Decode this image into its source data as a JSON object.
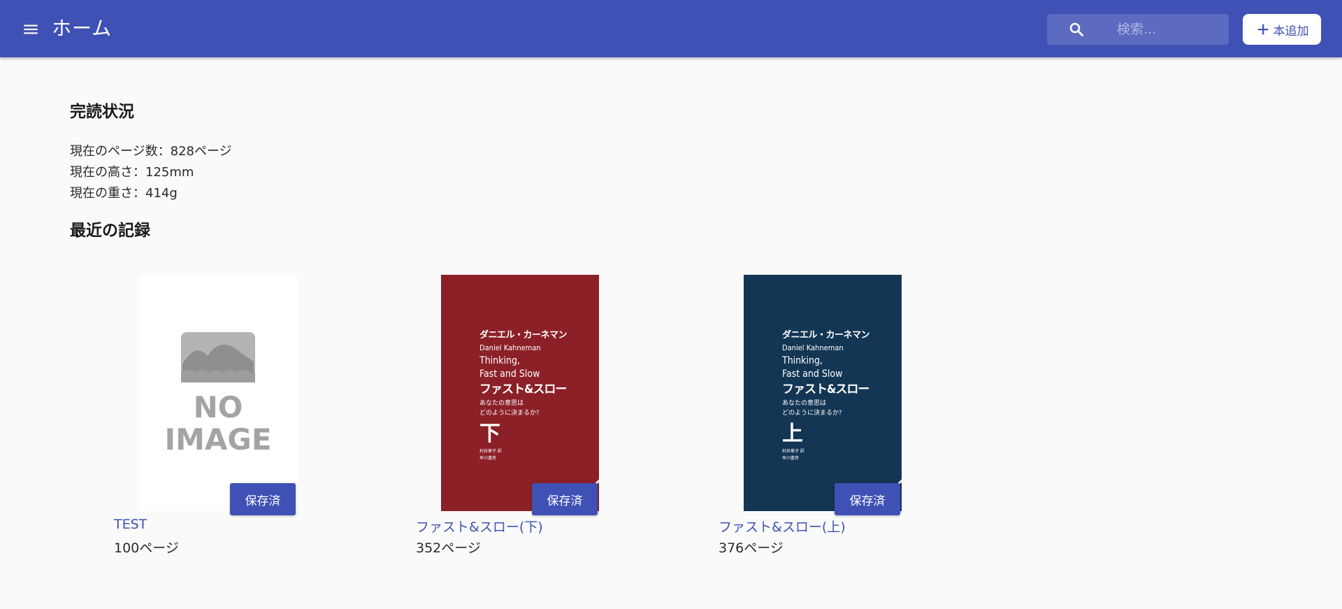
{
  "header": {
    "title": "ホーム",
    "search_placeholder": "検索...",
    "add_button_label": "本追加"
  },
  "status": {
    "heading": "完読状況",
    "pages_line": "現在のページ数：828ページ",
    "height_line": "現在の高さ：125mm",
    "weight_line": "現在の重さ：414g"
  },
  "recent": {
    "heading": "最近の記録",
    "books": [
      {
        "title": "TEST",
        "pages": "100ページ",
        "saved_label": "保存済",
        "cover_text": {
          "line1": "NO",
          "line2": "IMAGE"
        }
      },
      {
        "title": "ファスト&スロー(下)",
        "pages": "352ページ",
        "saved_label": "保存済",
        "cover_text": {
          "author_ja": "ダニエル・カーネマン",
          "author_en": "Daniel Kahneman",
          "title_en_1": "Thinking,",
          "title_en_2": "Fast and Slow",
          "title_ja": "ファスト&スロー",
          "subtitle_1": "あなたの意思は",
          "subtitle_2": "どのように決まるか?",
          "volume": "下",
          "translator": "村井章子 訳",
          "publisher": "早川書房"
        },
        "cover_color": "#8b2027"
      },
      {
        "title": "ファスト&スロー(上)",
        "pages": "376ページ",
        "saved_label": "保存済",
        "cover_text": {
          "author_ja": "ダニエル・カーネマン",
          "author_en": "Daniel Kahneman",
          "title_en_1": "Thinking,",
          "title_en_2": "Fast and Slow",
          "title_ja": "ファスト&スロー",
          "subtitle_1": "あなたの意思は",
          "subtitle_2": "どのように決まるか?",
          "volume": "上",
          "translator": "村井章子 訳",
          "publisher": "早川書房"
        },
        "cover_color": "#143655"
      }
    ]
  },
  "colors": {
    "primary": "#3f51b5",
    "search_bg": "#5c6bc0",
    "page_bg": "#fafafa"
  },
  "icons": {
    "menu": "menu-icon",
    "search": "search-icon",
    "add": "plus-icon"
  }
}
